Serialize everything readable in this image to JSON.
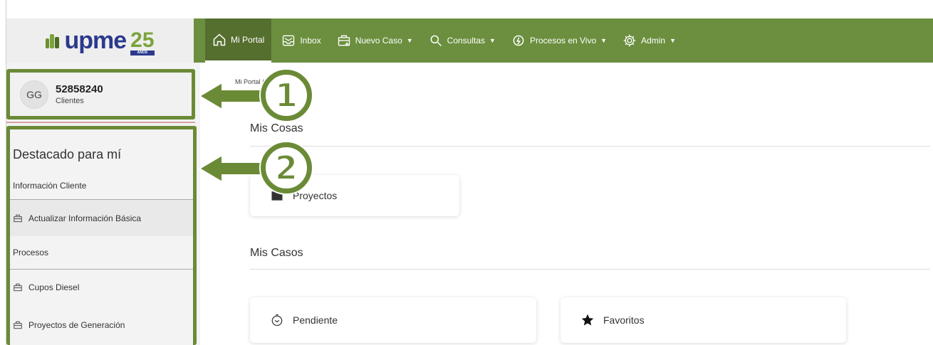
{
  "brand": {
    "logo_text": "upme",
    "logo_number": "25",
    "logo_sub": "AÑOS"
  },
  "nav": {
    "items": [
      {
        "label": "Mi Portal",
        "icon": "home-icon",
        "caret": false,
        "active": true
      },
      {
        "label": "Inbox",
        "icon": "inbox-icon",
        "caret": false
      },
      {
        "label": "Nuevo Caso",
        "icon": "new-case-icon",
        "caret": true
      },
      {
        "label": "Consultas",
        "icon": "search-icon",
        "caret": true
      },
      {
        "label": "Procesos en Vivo",
        "icon": "live-process-icon",
        "caret": true
      },
      {
        "label": "Admin",
        "icon": "gear-icon",
        "caret": true
      }
    ],
    "caret_glyph": "▼"
  },
  "user": {
    "initials": "GG",
    "id": "52858240",
    "role": "Clientes"
  },
  "sidebar": {
    "heading": "Destacado para mí",
    "items": [
      {
        "label": "Información Cliente",
        "icon": ""
      },
      {
        "label": "Actualizar Información Básica",
        "icon": "case-icon"
      },
      {
        "label": "Procesos",
        "icon": ""
      },
      {
        "label": "Cupos Diesel",
        "icon": "case-icon"
      },
      {
        "label": "Proyectos de Generación",
        "icon": "case-icon"
      }
    ]
  },
  "main": {
    "breadcrumb": "Mi Portal /",
    "mis_cosas": "Mis Cosas",
    "proyectos_card": "Proyectos",
    "mis_casos": "Mis Casos",
    "pendiente_card": "Pendiente",
    "favoritos_card": "Favoritos"
  },
  "callouts": {
    "one": "1",
    "two": "2"
  },
  "colors": {
    "nav_bg": "#6b8f3e",
    "accent_green": "#6b8a36",
    "sidebar_bg": "#f3f3f3"
  }
}
